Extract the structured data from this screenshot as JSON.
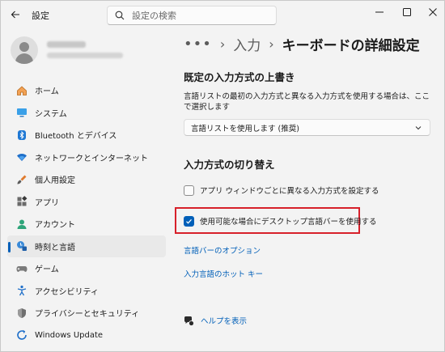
{
  "window": {
    "title": "設定"
  },
  "search": {
    "placeholder": "設定の検索"
  },
  "sidebar": {
    "items": [
      {
        "label": "ホーム",
        "icon": "home-icon",
        "active": false
      },
      {
        "label": "システム",
        "icon": "system-icon",
        "active": false
      },
      {
        "label": "Bluetooth とデバイス",
        "icon": "bluetooth-icon",
        "active": false
      },
      {
        "label": "ネットワークとインターネット",
        "icon": "wifi-icon",
        "active": false
      },
      {
        "label": "個人用設定",
        "icon": "brush-icon",
        "active": false
      },
      {
        "label": "アプリ",
        "icon": "apps-icon",
        "active": false
      },
      {
        "label": "アカウント",
        "icon": "account-icon",
        "active": false
      },
      {
        "label": "時刻と言語",
        "icon": "clock-language-icon",
        "active": true
      },
      {
        "label": "ゲーム",
        "icon": "gamepad-icon",
        "active": false
      },
      {
        "label": "アクセシビリティ",
        "icon": "accessibility-icon",
        "active": false
      },
      {
        "label": "プライバシーとセキュリティ",
        "icon": "shield-icon",
        "active": false
      },
      {
        "label": "Windows Update",
        "icon": "update-icon",
        "active": false
      }
    ]
  },
  "breadcrumb": {
    "dots": "•••",
    "parent": "入力",
    "current": "キーボードの詳細設定"
  },
  "override": {
    "title": "既定の入力方式の上書き",
    "description": "言語リストの最初の入力方式と異なる入力方式を使用する場合は、ここで選択します",
    "dropdown_value": "言語リストを使用します (推奨)"
  },
  "switching": {
    "title": "入力方式の切り替え",
    "per_app_label": "アプリ ウィンドウごとに異なる入力方式を設定する",
    "per_app_checked": false,
    "langbar_label": "使用可能な場合にデスクトップ言語バーを使用する",
    "langbar_checked": true
  },
  "links": {
    "langbar_options": "言語バーのオプション",
    "hotkeys": "入力言語のホット キー"
  },
  "help": {
    "label": "ヘルプを表示"
  },
  "colors": {
    "accent": "#005fb8",
    "highlight": "#d7202a"
  }
}
